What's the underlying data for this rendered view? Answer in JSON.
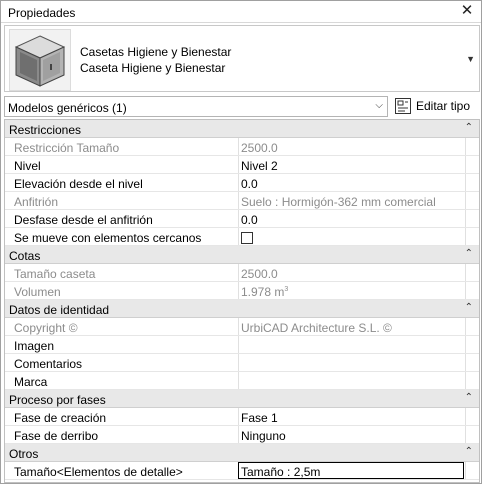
{
  "panel": {
    "title": "Propiedades"
  },
  "type_selector": {
    "family": "Casetas Higiene y Bienestar",
    "type": "Caseta Higiene y Bienestar"
  },
  "filter": {
    "selected": "Modelos genéricos (1)"
  },
  "edit_type": {
    "label": "Editar tipo"
  },
  "groups": {
    "restricciones": {
      "name": "Restricciones",
      "restriccion_tamano": {
        "label": "Restricción Tamaño",
        "value": "2500.0"
      },
      "nivel": {
        "label": "Nivel",
        "value": "Nivel 2"
      },
      "elevacion": {
        "label": "Elevación desde el nivel",
        "value": "0.0"
      },
      "anfitrion": {
        "label": "Anfitrión",
        "value": "Suelo : Hormigón-362 mm comercial"
      },
      "desfase": {
        "label": "Desfase desde el anfitrión",
        "value": "0.0"
      },
      "se_mueve": {
        "label": "Se mueve con elementos cercanos"
      }
    },
    "cotas": {
      "name": "Cotas",
      "tamano_caseta": {
        "label": "Tamaño caseta",
        "value": "2500.0"
      },
      "volumen": {
        "label": "Volumen",
        "value": "1.978 m",
        "unit_exp": "3"
      }
    },
    "identidad": {
      "name": "Datos de identidad",
      "copyright": {
        "label": "Copyright ©",
        "value": "UrbiCAD Architecture S.L. ©"
      },
      "imagen": {
        "label": "Imagen",
        "value": ""
      },
      "comentarios": {
        "label": "Comentarios",
        "value": ""
      },
      "marca": {
        "label": "Marca",
        "value": ""
      }
    },
    "fases": {
      "name": "Proceso por fases",
      "fase_creacion": {
        "label": "Fase de creación",
        "value": "Fase 1"
      },
      "fase_derribo": {
        "label": "Fase de derribo",
        "value": "Ninguno"
      }
    },
    "otros": {
      "name": "Otros",
      "tamano_detalle": {
        "label": "Tamaño<Elementos de detalle>",
        "value": "Tamaño : 2,5m"
      }
    }
  },
  "colors": {
    "group_header_bg": "#e8e8e8",
    "readonly_text": "#8c8c8c"
  },
  "icons": {
    "close": "close-icon",
    "collapse": "chevron-up-icon",
    "dropdown": "chevron-down-icon",
    "edit_type": "edit-type-icon"
  }
}
